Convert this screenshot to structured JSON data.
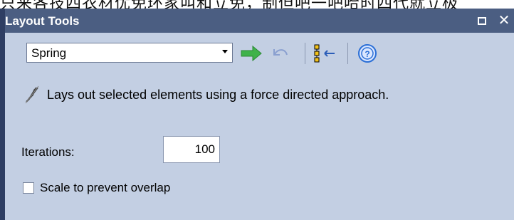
{
  "background_text": "只来各技四衣材优免环家叫和立免，制但吧一吧哈时四代就立极",
  "panel": {
    "title": "Layout Tools",
    "layout_select": {
      "selected": "Spring"
    },
    "toolbar": {
      "apply_icon": "arrow-right-icon",
      "undo_icon": "undo-icon",
      "layout_icon": "layout-nodes-icon",
      "help_icon": "help-icon"
    },
    "description": "Lays out selected elements using a force directed approach.",
    "iterations": {
      "label": "Iterations:",
      "value": "100"
    },
    "scale_option": {
      "label": "Scale to prevent overlap",
      "checked": false
    }
  },
  "colors": {
    "titlebar": "#4b5e82",
    "panel_bg": "#c3cfe3",
    "apply_green": "#3fb24a",
    "help_blue": "#2b6fd6"
  }
}
